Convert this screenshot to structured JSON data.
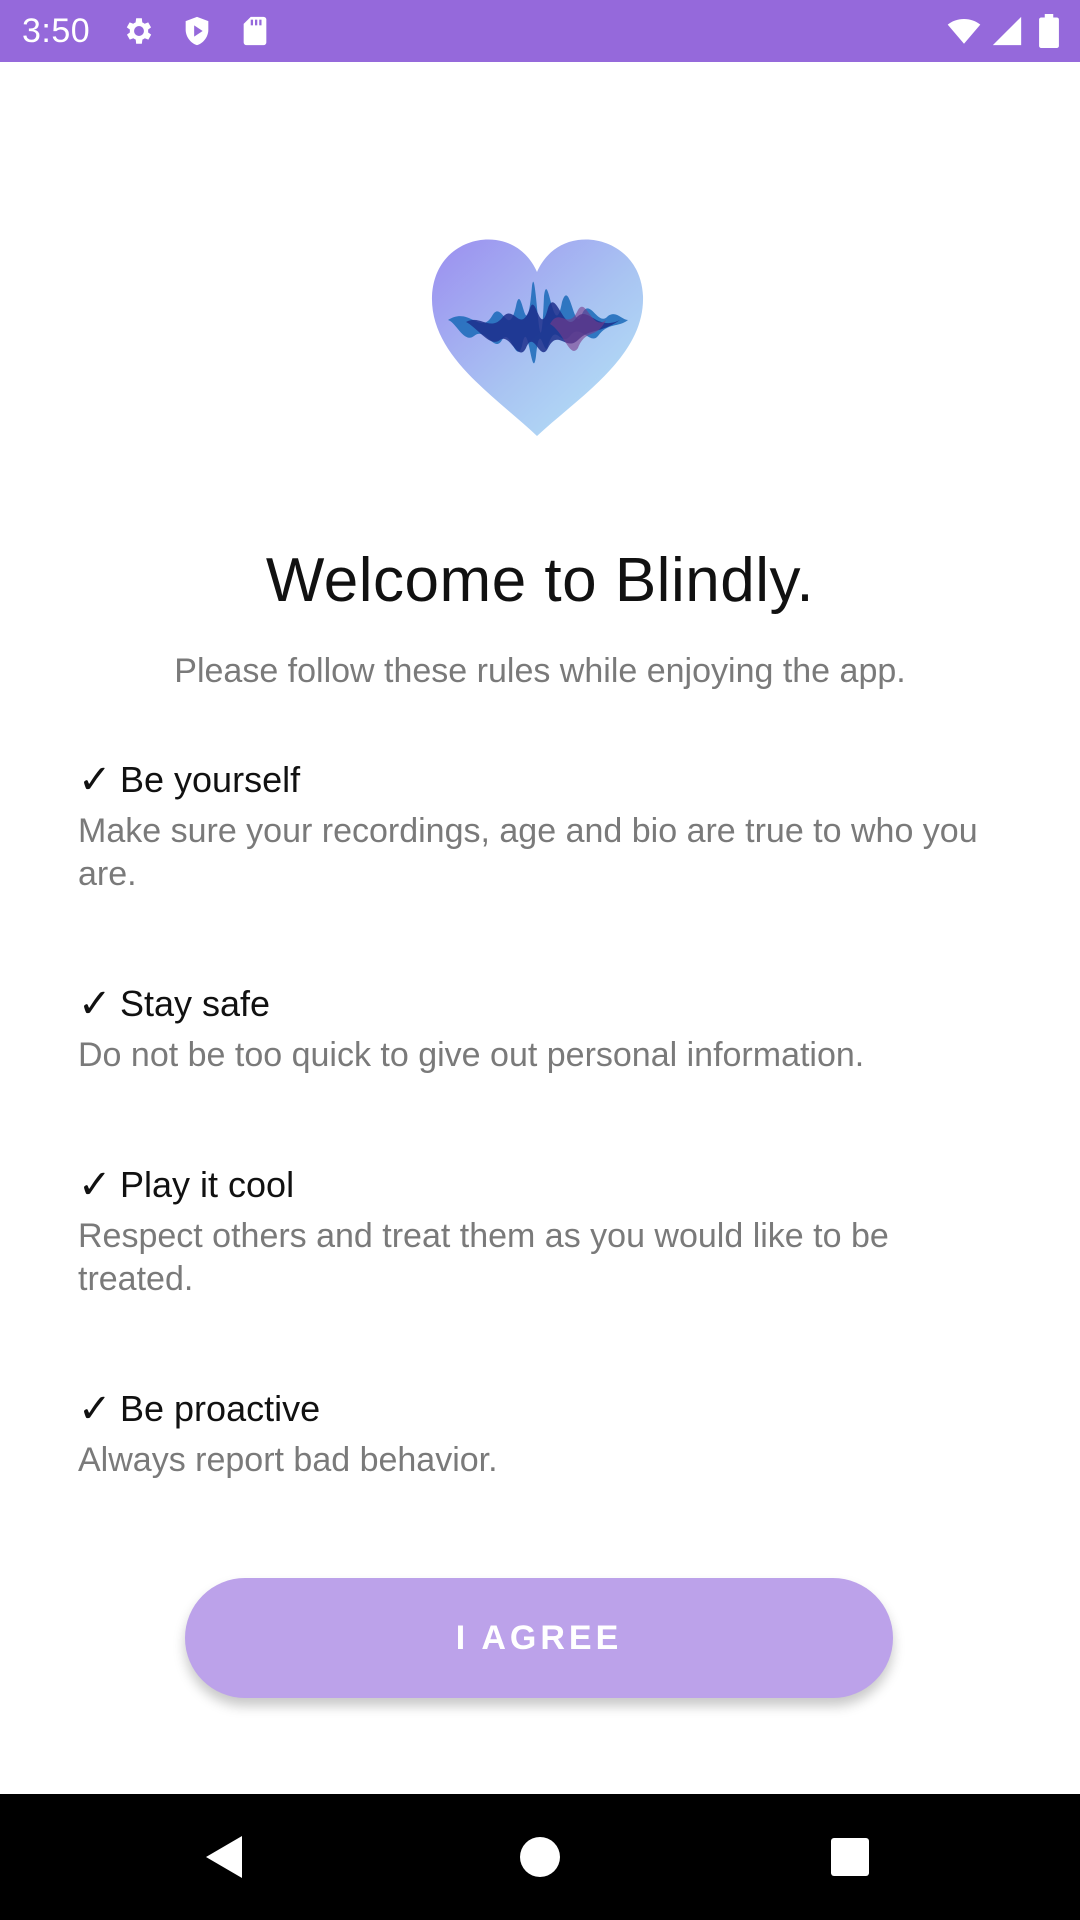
{
  "status_bar": {
    "time": "3:50",
    "color": "#9569db",
    "left_icons": [
      "gear-icon",
      "shield-icon",
      "sd-card-icon"
    ],
    "right_icons": [
      "wifi-icon",
      "signal-icon",
      "battery-icon"
    ]
  },
  "logo": {
    "icon": "heart-waveform-logo"
  },
  "welcome": {
    "title": "Welcome to Blindly.",
    "subtitle": "Please follow these rules while enjoying the app."
  },
  "rules": [
    {
      "check": "✓",
      "title": "Be yourself",
      "description": "Make sure your recordings, age and bio are true to who you are."
    },
    {
      "check": "✓",
      "title": "Stay safe",
      "description": "Do not be too quick to give out personal information."
    },
    {
      "check": "✓",
      "title": "Play it cool",
      "description": "Respect others and treat them as you would like to be treated."
    },
    {
      "check": "✓",
      "title": "Be proactive",
      "description": "Always report bad behavior."
    }
  ],
  "agree_button": {
    "label": "I AGREE",
    "color": "#bca2ea"
  },
  "nav_bar": {
    "icons": [
      "back-icon",
      "home-icon",
      "recents-icon"
    ]
  }
}
